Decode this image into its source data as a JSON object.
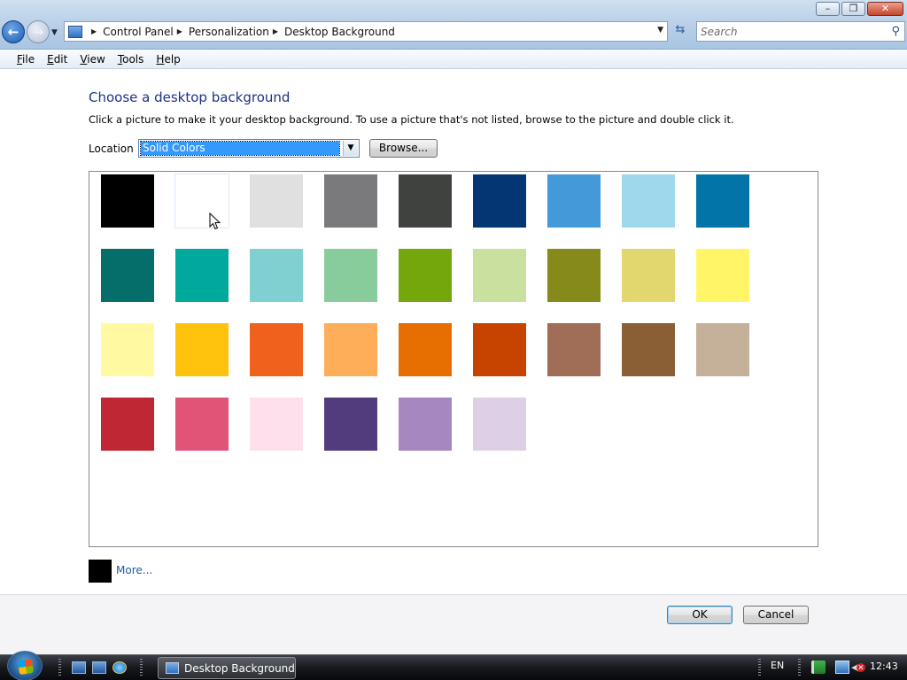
{
  "window": {
    "minimize_glyph": "–",
    "maximize_glyph": "❐",
    "close_glyph": "✕"
  },
  "address_bar": {
    "icon": "control-panel-icon",
    "breadcrumbs": [
      "Control Panel",
      "Personalization",
      "Desktop Background"
    ]
  },
  "search": {
    "placeholder": "Search"
  },
  "menu": [
    {
      "label": "File",
      "accel": "F",
      "rest": "ile"
    },
    {
      "label": "Edit",
      "accel": "E",
      "rest": "dit"
    },
    {
      "label": "View",
      "accel": "V",
      "rest": "iew"
    },
    {
      "label": "Tools",
      "accel": "T",
      "rest": "ools"
    },
    {
      "label": "Help",
      "accel": "H",
      "rest": "elp"
    }
  ],
  "page": {
    "title": "Choose a desktop background",
    "description": "Click a picture to make it your desktop background. To use a picture that's not listed, browse to the picture and double click it.",
    "location_label": "Location",
    "location_value": "Solid Colors",
    "browse_label": "Browse...",
    "more_label": "More...",
    "more_color": "#000000"
  },
  "swatches": [
    "#000000",
    "#ffffff",
    "#e0e0e0",
    "#7a797b",
    "#404240",
    "#033672",
    "#4499d9",
    "#9fd8ec",
    "#0274a8",
    "#056e6a",
    "#00a99b",
    "#7fd0d0",
    "#88cc9c",
    "#73a70b",
    "#c9e09e",
    "#868a1b",
    "#e2d76e",
    "#fff566",
    "#fff9a2",
    "#ffc20d",
    "#f0621c",
    "#fead58",
    "#e76f02",
    "#c74300",
    "#a06d56",
    "#8b5f36",
    "#c5b09a",
    "#c02734",
    "#e05477",
    "#fee0ed",
    "#523c7e",
    "#a687bf",
    "#ddd0e6"
  ],
  "selected_swatch_index": 1,
  "footer": {
    "ok_label": "OK",
    "cancel_label": "Cancel"
  },
  "taskbar": {
    "task_label": "Desktop Background",
    "language": "EN",
    "clock": "12:43"
  }
}
